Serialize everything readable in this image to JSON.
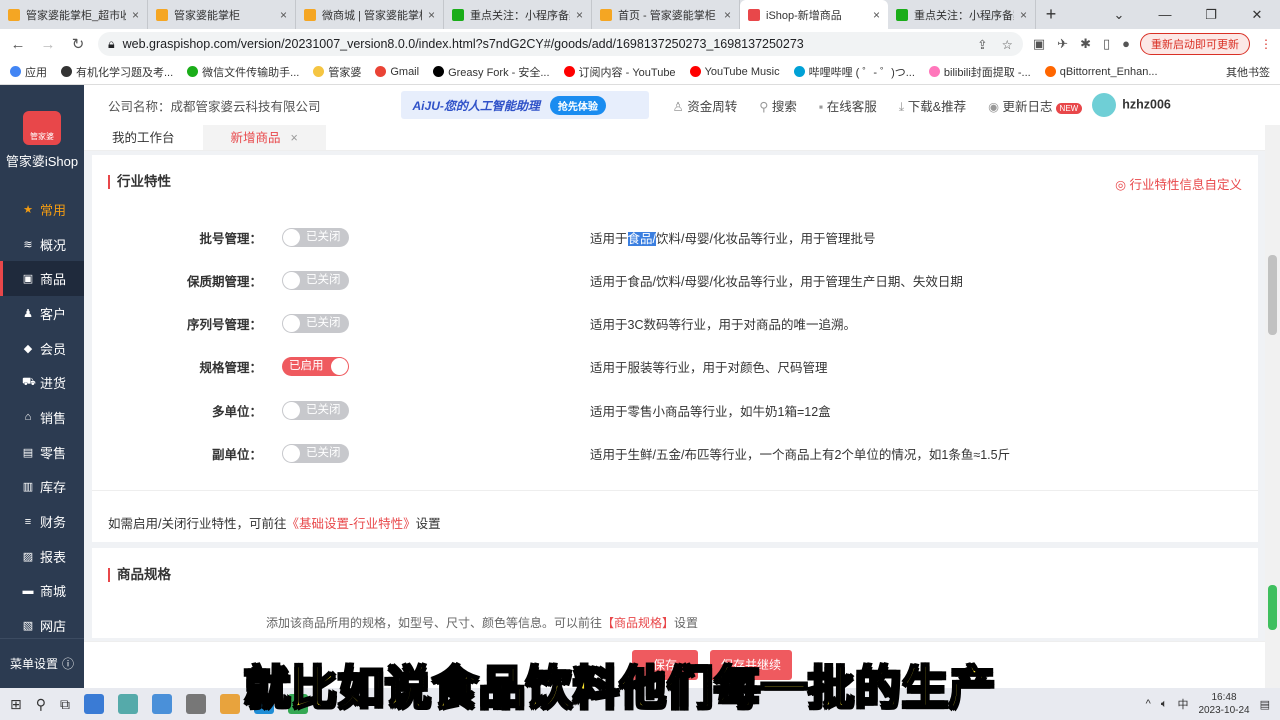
{
  "browser": {
    "tabs": [
      {
        "title": "管家婆能掌柜_超市收",
        "color": "#f5a623"
      },
      {
        "title": "管家婆能掌柜",
        "color": "#f5a623"
      },
      {
        "title": "微商城 | 管家婆能掌柜",
        "color": "#f5a623"
      },
      {
        "title": "重点关注：小程序备案",
        "color": "#1aad19"
      },
      {
        "title": "首页 - 管家婆能掌柜",
        "color": "#f5a623"
      },
      {
        "title": "iShop-新增商品",
        "color": "#e8474a",
        "active": true
      },
      {
        "title": "重点关注：小程序备案",
        "color": "#1aad19"
      }
    ],
    "url": "web.graspishop.com/version/20231007_version8.0.0/index.html?s7ndG2CY#/goods/add/1698137250273_1698137250273",
    "restart_label": "重新启动即可更新",
    "bookmarks": [
      "应用",
      "有机化学习题及考...",
      "微信文件传输助手...",
      "管家婆",
      "Gmail",
      "Greasy Fork - 安全...",
      "订阅内容 - YouTube",
      "YouTube Music",
      "哔哩哔哩 ( ゜- ゜)つ...",
      "bilibili封面提取 -...",
      "qBittorrent_Enhan..."
    ],
    "other_bookmarks": "其他书签"
  },
  "sidebar": {
    "brand": "管家婆iShop",
    "logo_text": "管家婆",
    "items": [
      {
        "label": "常用",
        "icon": "star-icon"
      },
      {
        "label": "概况",
        "icon": "layers-icon"
      },
      {
        "label": "商品",
        "icon": "goods-icon",
        "active": true
      },
      {
        "label": "客户",
        "icon": "customer-icon"
      },
      {
        "label": "会员",
        "icon": "diamond-icon"
      },
      {
        "label": "进货",
        "icon": "cart-icon"
      },
      {
        "label": "销售",
        "icon": "basket-icon"
      },
      {
        "label": "零售",
        "icon": "store-icon"
      },
      {
        "label": "库存",
        "icon": "warehouse-icon"
      },
      {
        "label": "财务",
        "icon": "database-icon"
      },
      {
        "label": "报表",
        "icon": "chart-icon"
      },
      {
        "label": "商城",
        "icon": "mall-icon"
      },
      {
        "label": "网店",
        "icon": "shop-icon"
      }
    ],
    "menu_settings": "菜单设置"
  },
  "header": {
    "company": "公司名称：成都管家婆云科技有限公司",
    "ai_banner": "AiJU-您的人工智能助理",
    "ai_try": "抢先体验",
    "links": [
      "资金周转",
      "搜索",
      "在线客服",
      "下载&推荐",
      "更新日志"
    ],
    "new_badge": "NEW",
    "user": "hzhz006"
  },
  "page_tabs": [
    {
      "label": "我的工作台"
    },
    {
      "label": "新增商品",
      "active": true
    }
  ],
  "industry": {
    "title": "行业特性",
    "customize": "行业特性信息自定义",
    "rows": [
      {
        "label": "批号管理：",
        "state": "已关闭",
        "on": false,
        "desc_pre": "适用于",
        "desc_hl": "食品/",
        "desc_post": "饮料/母婴/化妆品等行业，用于管理批号"
      },
      {
        "label": "保质期管理：",
        "state": "已关闭",
        "on": false,
        "desc_pre": "适用于食品/饮料/母婴/化妆品等行业，用于管理生产日期、失效日期",
        "desc_hl": "",
        "desc_post": ""
      },
      {
        "label": "序列号管理：",
        "state": "已关闭",
        "on": false,
        "desc_pre": "适用于3C数码等行业，用于对商品的唯一追溯。",
        "desc_hl": "",
        "desc_post": ""
      },
      {
        "label": "规格管理：",
        "state": "已启用",
        "on": true,
        "desc_pre": "适用于服装等行业，用于对颜色、尺码管理",
        "desc_hl": "",
        "desc_post": ""
      },
      {
        "label": "多单位：",
        "state": "已关闭",
        "on": false,
        "desc_pre": "适用于零售小商品等行业，如牛奶1箱=12盒",
        "desc_hl": "",
        "desc_post": ""
      },
      {
        "label": "副单位：",
        "state": "已关闭",
        "on": false,
        "desc_pre": "适用于生鲜/五金/布匹等行业，一个商品上有2个单位的情况，如1条鱼≈1.5斤",
        "desc_hl": "",
        "desc_post": ""
      }
    ],
    "note_pre": "如需启用/关闭行业特性，可前往",
    "note_link": "《基础设置-行业特性》",
    "note_post": "设置"
  },
  "spec": {
    "title": "商品规格",
    "sub_pre": "添加该商品所用的规格，如型号、尺寸、颜色等信息。可以前往",
    "sub_link": "【商品规格】",
    "sub_post": "设置"
  },
  "footer": {
    "buttons": [
      "保存",
      "保存并继续"
    ]
  },
  "taskbar": {
    "time": "16:48",
    "date": "2023-10-24",
    "ime": "中"
  },
  "subtitle": "就比如说食品饮料他们每一批的生产"
}
